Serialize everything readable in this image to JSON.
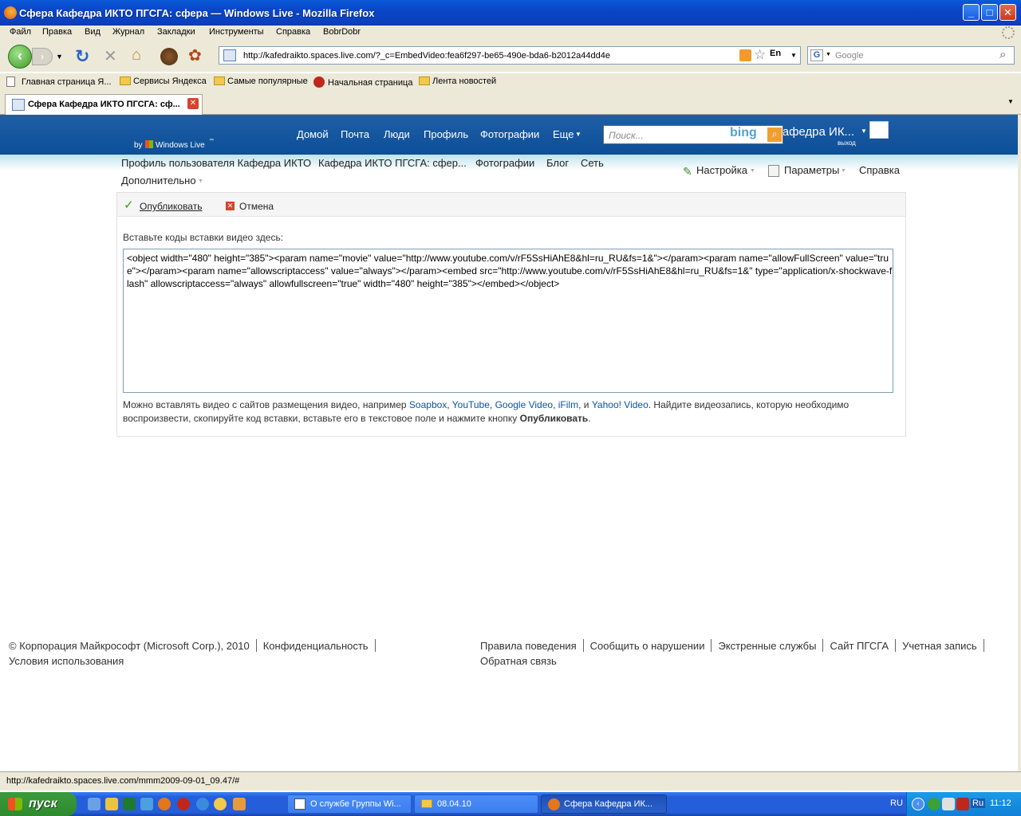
{
  "window": {
    "title": "Сфера Кафедра ИКТО ПГСГА: сфера — Windows Live - Mozilla Firefox"
  },
  "menu": [
    "Файл",
    "Правка",
    "Вид",
    "Журнал",
    "Закладки",
    "Инструменты",
    "Справка",
    "BobrDobr"
  ],
  "address": {
    "url": "http://kafedraikto.spaces.live.com/?_c=EmbedVideo:fea6f297-be65-490e-bda6-b2012a44dd4e",
    "lang": "En"
  },
  "search_engine": {
    "placeholder": "Google"
  },
  "bookmarks": [
    "Главная страница Я...",
    "Сервисы Яндекса",
    "Самые популярные",
    "Начальная страница",
    "Лента новостей"
  ],
  "tab": {
    "title": "Сфера Кафедра ИКТО ПГСГА: сф..."
  },
  "live": {
    "by": "by",
    "brand": "Windows Live",
    "tm": "™",
    "nav": [
      "Домой",
      "Почта",
      "Люди",
      "Профиль",
      "Фотографии",
      "Еще"
    ],
    "search_placeholder": "Поиск...",
    "bing": "bing",
    "user": "Кафедра ИК...",
    "signout": "выход"
  },
  "subnav": {
    "items": [
      "Профиль пользователя Кафедра ИКТО",
      "Кафедра ИКТО ПГСГА: сфер...",
      "Фотографии",
      "Блог",
      "Сеть"
    ],
    "more": "Дополнительно",
    "right": [
      "Настройка",
      "Параметры",
      "Справка"
    ]
  },
  "editor": {
    "publish": "Опубликовать",
    "cancel": "Отмена",
    "prompt": "Вставьте коды вставки видео здесь:",
    "code": "<object width=\"480\" height=\"385\"><param name=\"movie\" value=\"http://www.youtube.com/v/rF5SsHiAhE8&hl=ru_RU&fs=1&\"></param><param name=\"allowFullScreen\" value=\"true\"></param><param name=\"allowscriptaccess\" value=\"always\"></param><embed src=\"http://www.youtube.com/v/rF5SsHiAhE8&hl=ru_RU&fs=1&\" type=\"application/x-shockwave-flash\" allowscriptaccess=\"always\" allowfullscreen=\"true\" width=\"480\" height=\"385\"></embed></object>",
    "help_pre": "Можно вставлять видео с сайтов размещения видео, например ",
    "sites": [
      "Soapbox",
      "YouTube",
      "Google Video",
      "iFilm",
      "Yahoo! Video"
    ],
    "help_mid": ". Найдите видеозапись, которую необходимо воспроизвести, скопируйте код вставки, вставьте его в текстовое поле и нажмите кнопку ",
    "help_bold": "Опубликовать",
    "help_end": "."
  },
  "footer": {
    "left": [
      "© Корпорация Майкрософт (Microsoft Corp.), 2010",
      "Конфиденциальность",
      "Условия использования"
    ],
    "right": [
      "Правила поведения",
      "Сообщить о нарушении",
      "Экстренные службы",
      "Сайт ПГСГА",
      "Учетная запись",
      "Обратная связь"
    ]
  },
  "status": "http://kafedraikto.spaces.live.com/mmm2009-09-01_09.47/#",
  "taskbar": {
    "start": "пуск",
    "buttons": [
      "О службе Группы Wi...",
      "08.04.10",
      "Сфера Кафедра ИК..."
    ],
    "lang": "RU",
    "tray_lang": "Ru",
    "time": "11:12"
  }
}
